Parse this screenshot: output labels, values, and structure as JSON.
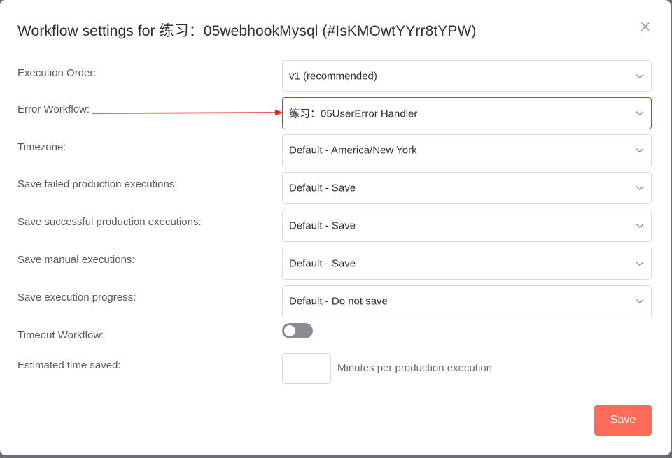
{
  "dialog": {
    "title": "Workflow settings for 练习：05webhookMysql (#IsKMOwtYYrr8tYPW)",
    "close_icon": "close-icon"
  },
  "settings": {
    "execution_order": {
      "label": "Execution Order:",
      "value": "v1 (recommended)"
    },
    "error_workflow": {
      "label": "Error Workflow:",
      "value": "练习：05UserError Handler"
    },
    "timezone": {
      "label": "Timezone:",
      "value": "Default - America/New York"
    },
    "save_failed": {
      "label": "Save failed production executions:",
      "value": "Default - Save"
    },
    "save_successful": {
      "label": "Save successful production executions:",
      "value": "Default - Save"
    },
    "save_manual": {
      "label": "Save manual executions:",
      "value": "Default - Save"
    },
    "save_progress": {
      "label": "Save execution progress:",
      "value": "Default - Do not save"
    },
    "timeout_workflow": {
      "label": "Timeout Workflow:",
      "enabled": false
    },
    "estimated_time_saved": {
      "label": "Estimated time saved:",
      "value": "",
      "suffix": "Minutes per production execution"
    }
  },
  "footer": {
    "save_label": "Save"
  },
  "colors": {
    "accent": "#ff6d5a",
    "focus_border": "#5b4fd0",
    "annotation_arrow": "#e8281e"
  }
}
